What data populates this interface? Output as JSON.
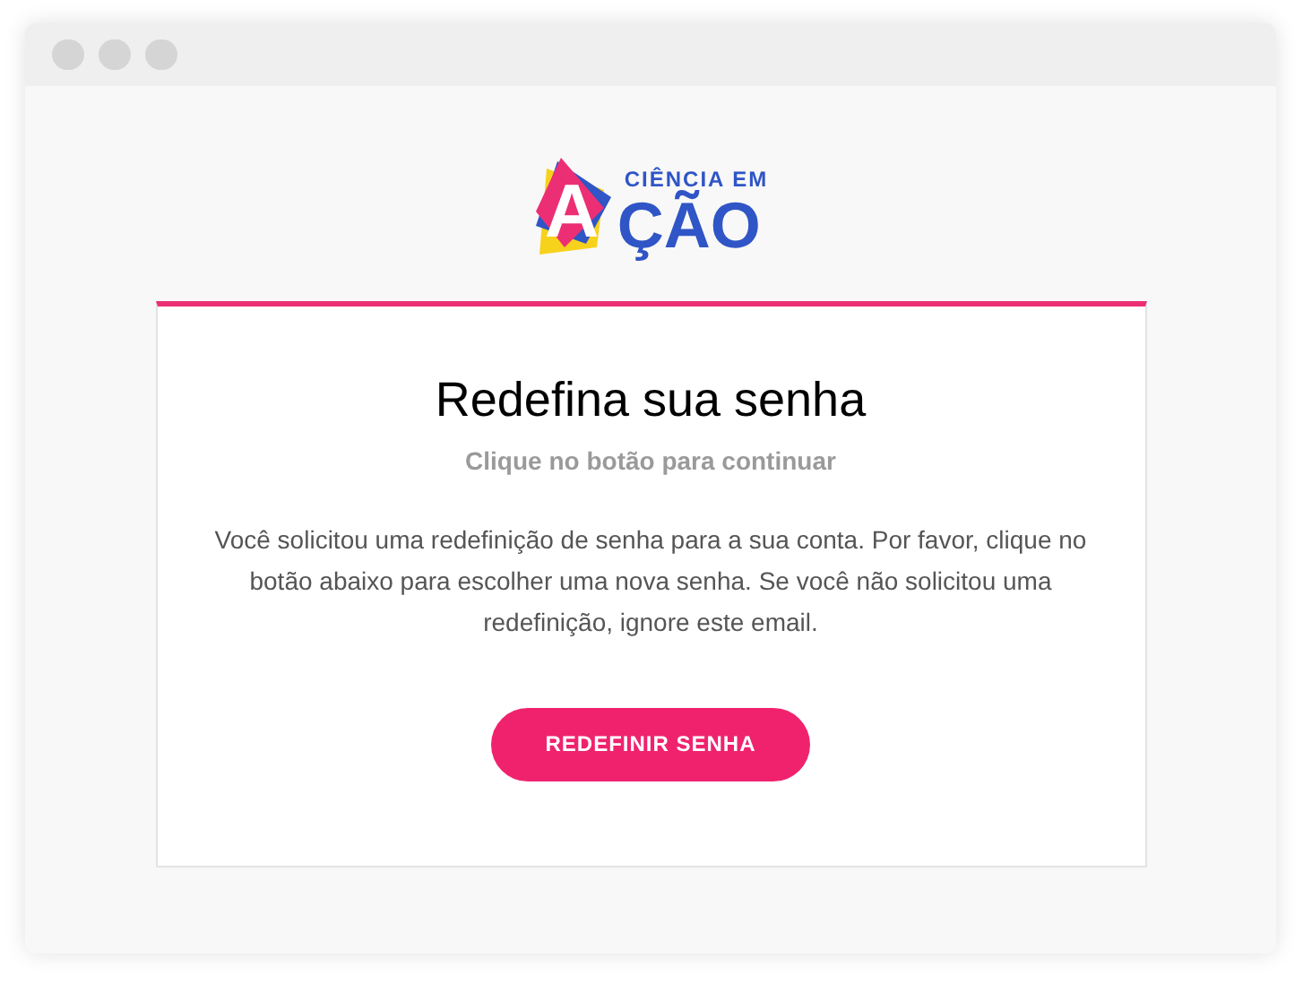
{
  "logo": {
    "top_line": "CIÊNCIA EM",
    "initial": "A",
    "rest": "ÇÃO"
  },
  "card": {
    "title": "Redefina sua senha",
    "subtitle": "Clique no botão para continuar",
    "message": "Você solicitou uma redefinição de senha para a sua conta. Por favor, clique no botão abaixo para escolher uma nova senha. Se você não solicitou uma redefinição, ignore este email.",
    "button": "REDEFINIR SENHA"
  }
}
